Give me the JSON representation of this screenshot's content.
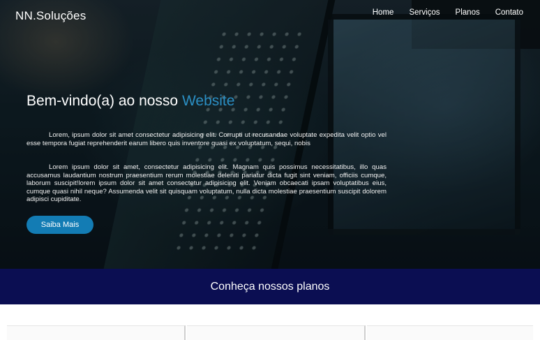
{
  "header": {
    "brand": "NN.Soluções",
    "nav": [
      "Home",
      "Serviços",
      "Planos",
      "Contato"
    ]
  },
  "hero": {
    "title_prefix": "Bem-vindo(a) ao nosso ",
    "title_accent": "Website",
    "paragraph_1": "Lorem, ipsum dolor sit amet consectetur adipisicing elit. Corrupti ut recusandae voluptate expedita velit optio vel esse tempora fugiat reprehenderit earum libero quis inventore quasi ex voluptatum, sequi, nobis",
    "paragraph_2": "Lorem ipsum dolor sit amet, consectetur adipisicing elit. Magnam quis possimus necessitatibus, illo quas accusamus laudantium nostrum praesentium rerum molestiae deleniti pariatur dicta fugit sint veniam, officiis cumque, laborum suscipit!lorem ipsum dolor sit amet consectetur adipisicing elit. Veniam obcaecati ipsam voluptatibus eius, cumque quasi nihil neque? Assumenda velit sit quisquam voluptatum, nulla dicta molestiae praesentium suscipit dolorem adipisci cupiditate.",
    "cta_label": "Saiba Mais"
  },
  "plans": {
    "title": "Conheça nossos planos"
  },
  "colors": {
    "accent": "#2b8fc4",
    "button": "#137cb4",
    "band": "#0b0e52"
  }
}
